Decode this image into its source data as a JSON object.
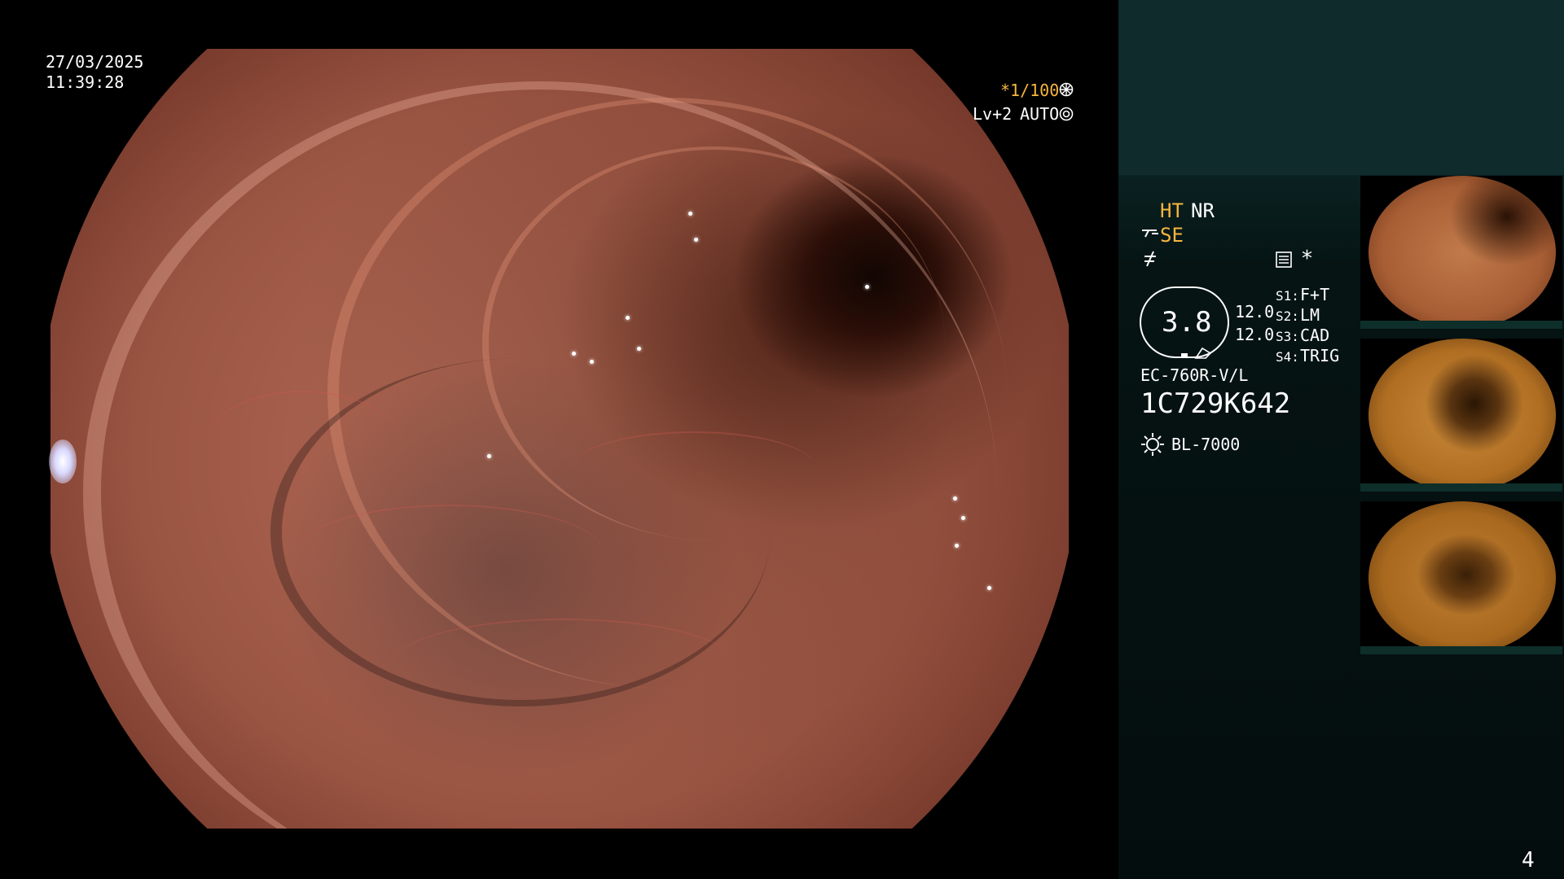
{
  "timestamp": {
    "date": "27/03/2025",
    "time": "11:39:28"
  },
  "exposure": {
    "shutter": "*1/100",
    "level": "Lv+2",
    "mode": "AUTO"
  },
  "settings": {
    "ht": "HT",
    "nr": "NR",
    "se": "SE",
    "zoom": "3.8",
    "value_1": "12.0",
    "value_2": "12.0",
    "s1_label": "S1:",
    "s1_value": "F+T",
    "s2_label": "S2:",
    "s2_value": "LM",
    "s3_label": "S3:",
    "s3_value": "CAD",
    "s4_label": "S4:",
    "s4_value": "TRIG"
  },
  "scope_model": "EC-760R-V/L",
  "scope_serial": "1C729K642",
  "light_source": "BL-7000",
  "thumbnails": [
    {
      "tone": "#b0683e",
      "lumen": "#2a1206"
    },
    {
      "tone": "#c87a32",
      "lumen": "#2a1604"
    },
    {
      "tone": "#b87028",
      "lumen": "#3a2008"
    }
  ],
  "page_number": "4",
  "colors": {
    "accent": "#f6b640",
    "panel": "#0f2b2b"
  }
}
